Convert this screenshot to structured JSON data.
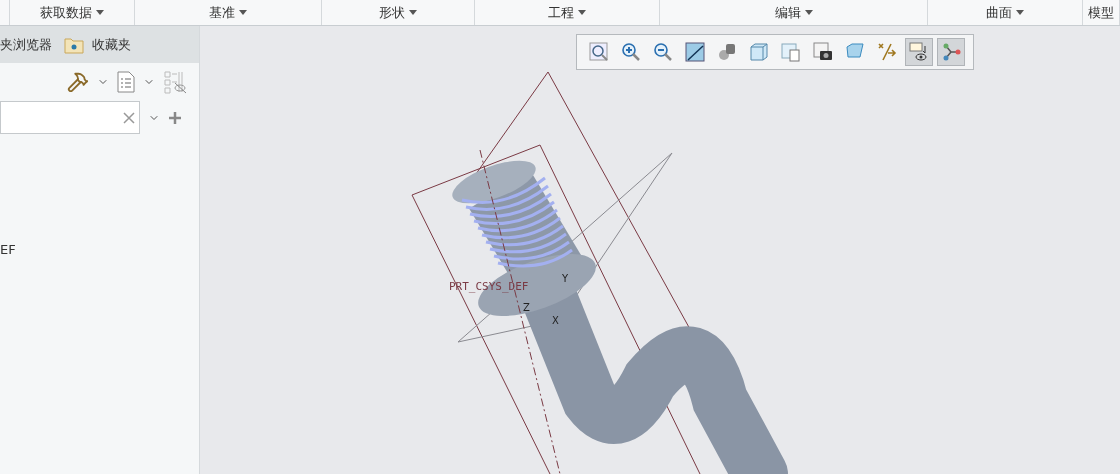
{
  "ribbon_groups": [
    {
      "label": "获取数据"
    },
    {
      "label": "基准"
    },
    {
      "label": "形状"
    },
    {
      "label": "工程"
    },
    {
      "label": "编辑"
    },
    {
      "label": "曲面"
    },
    {
      "label": "模型"
    }
  ],
  "left_panel": {
    "tabs": [
      {
        "label": "夹浏览器",
        "kind": "plain"
      },
      {
        "label": "收藏夹",
        "kind": "favorites"
      }
    ],
    "tree_items": [
      {
        "label": "EF"
      }
    ]
  },
  "view_toolbar": [
    {
      "kind": "refit",
      "selected": false
    },
    {
      "kind": "zoom-in",
      "selected": false
    },
    {
      "kind": "zoom-out",
      "selected": false
    },
    {
      "kind": "repaint",
      "selected": false
    },
    {
      "kind": "shading",
      "selected": false
    },
    {
      "kind": "cube",
      "selected": false
    },
    {
      "kind": "saved-views",
      "selected": false
    },
    {
      "kind": "camera",
      "selected": false
    },
    {
      "kind": "section",
      "selected": false
    },
    {
      "kind": "datum",
      "selected": false
    },
    {
      "kind": "annotation",
      "selected": true
    },
    {
      "kind": "spin-center",
      "selected": true
    }
  ],
  "viewport": {
    "csys_label": "PRT_CSYS_DEF",
    "axes": [
      {
        "label": "Y"
      },
      {
        "label": "Z"
      },
      {
        "label": "X"
      }
    ]
  }
}
